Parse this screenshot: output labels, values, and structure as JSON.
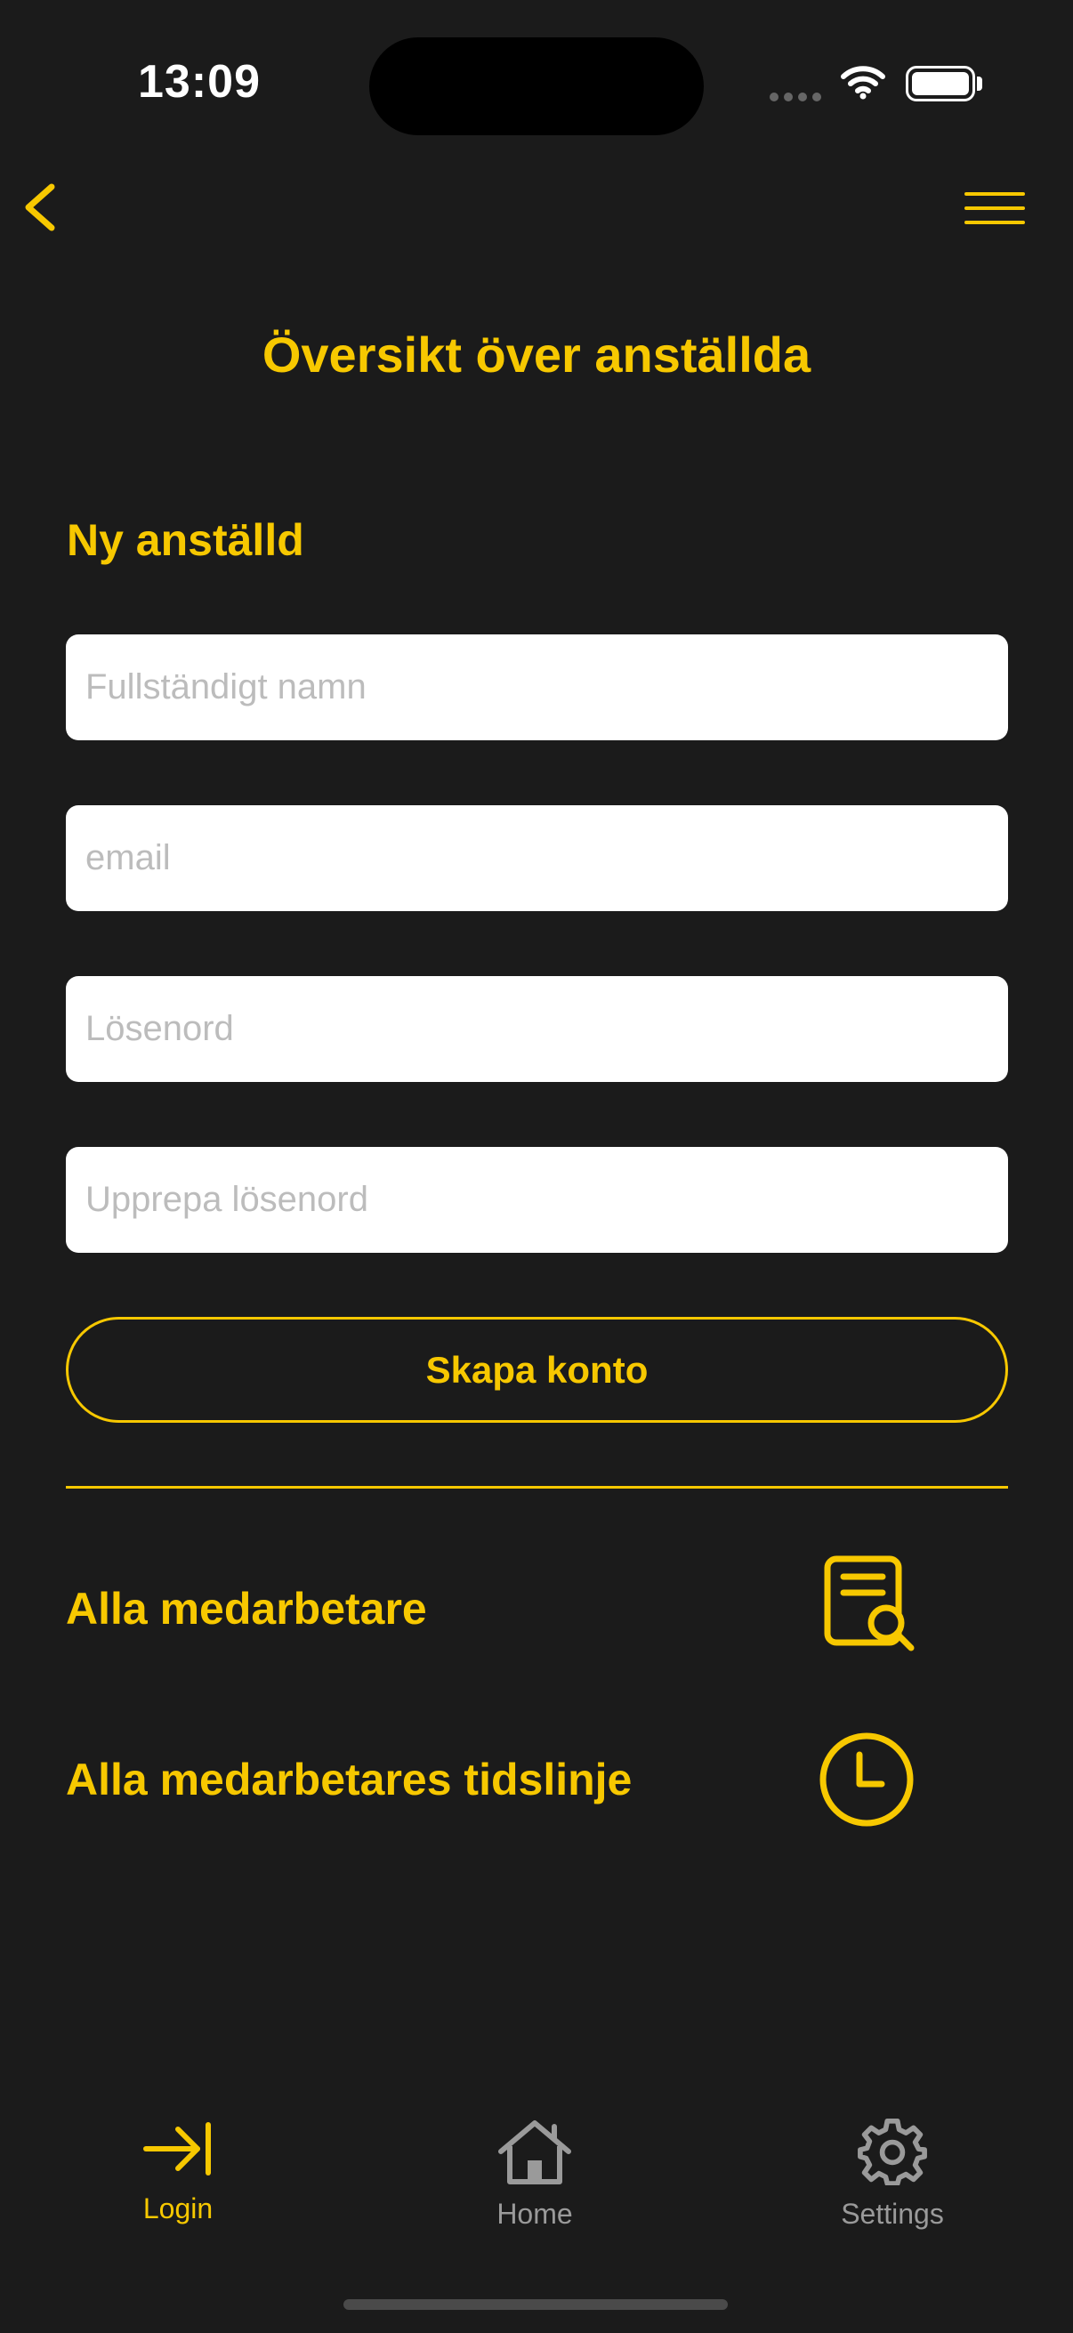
{
  "status_bar": {
    "time": "13:09"
  },
  "header": {
    "title": "Översikt över anställda"
  },
  "form": {
    "section_title": "Ny anställd",
    "fields": [
      {
        "placeholder": "Fullständigt namn",
        "value": ""
      },
      {
        "placeholder": "email",
        "value": ""
      },
      {
        "placeholder": "Lösenord",
        "value": ""
      },
      {
        "placeholder": "Upprepa lösenord",
        "value": ""
      }
    ],
    "submit_label": "Skapa konto"
  },
  "links": [
    {
      "label": "Alla medarbetare",
      "icon": "document-search-icon"
    },
    {
      "label": "Alla medarbetares tidslinje",
      "icon": "clock-icon"
    }
  ],
  "tab_bar": {
    "items": [
      {
        "label": "Login",
        "icon": "login-arrow-icon",
        "active": true
      },
      {
        "label": "Home",
        "icon": "home-icon",
        "active": false
      },
      {
        "label": "Settings",
        "icon": "gear-icon",
        "active": false
      }
    ]
  },
  "colors": {
    "accent": "#f7c800",
    "background": "#1b1b1b",
    "inactive": "#9a9a9a"
  }
}
